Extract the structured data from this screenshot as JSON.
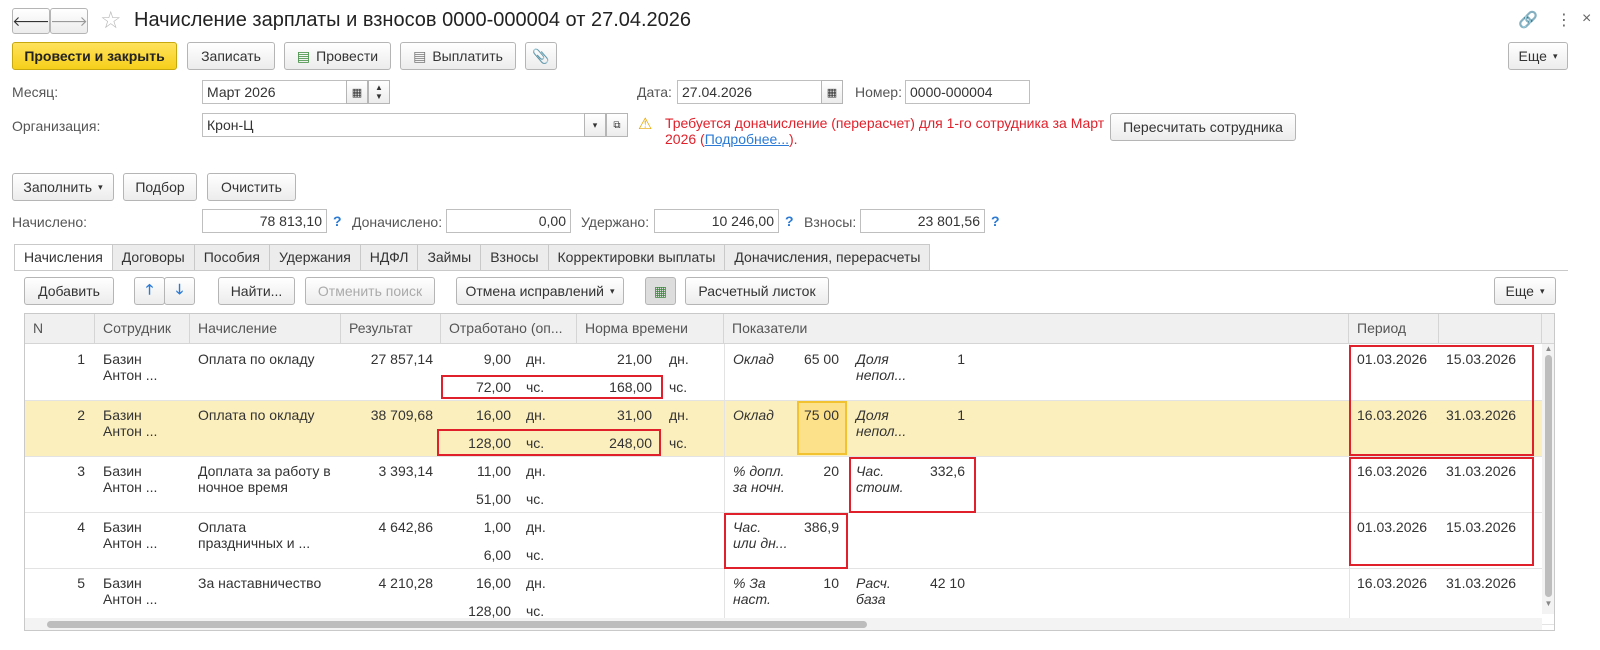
{
  "window": {
    "title": "Начисление зарплаты и взносов 0000-000004 от 27.04.2026"
  },
  "toolbar": {
    "post_close": "Провести и закрыть",
    "save": "Записать",
    "post": "Провести",
    "pay": "Выплатить",
    "more": "Еще"
  },
  "form": {
    "month_label": "Месяц:",
    "month_value": "Март 2026",
    "date_label": "Дата:",
    "date_value": "27.04.2026",
    "number_label": "Номер:",
    "number_value": "0000-000004",
    "org_label": "Организация:",
    "org_value": "Крон-Ц",
    "warning_text": "Требуется доначисление (перерасчет) для 1-го сотрудника за Март 2026 (",
    "warning_link": "Подробнее...",
    "warning_end": ").",
    "recalc_button": "Пересчитать сотрудника"
  },
  "actions": {
    "fill": "Заполнить",
    "select": "Подбор",
    "clear": "Очистить"
  },
  "totals": {
    "accrued_label": "Начислено:",
    "accrued_value": "78 813,10",
    "extra_label": "Доначислено:",
    "extra_value": "0,00",
    "withheld_label": "Удержано:",
    "withheld_value": "10 246,00",
    "contrib_label": "Взносы:",
    "contrib_value": "23 801,56",
    "help": "?"
  },
  "tabs": [
    "Начисления",
    "Договоры",
    "Пособия",
    "Удержания",
    "НДФЛ",
    "Займы",
    "Взносы",
    "Корректировки выплаты",
    "Доначисления, перерасчеты"
  ],
  "grid_toolbar": {
    "add": "Добавить",
    "find": "Найти...",
    "cancel_search": "Отменить поиск",
    "cancel_fixes": "Отмена исправлений",
    "payslip": "Расчетный листок",
    "more": "Еще"
  },
  "columns": {
    "n": "N",
    "employee": "Сотрудник",
    "accrual": "Начисление",
    "result": "Результат",
    "worked": "Отработано (оп...",
    "norm": "Норма времени",
    "indicators": "Показатели",
    "period": "Период"
  },
  "rows": [
    {
      "n": "1",
      "emp1": "Базин",
      "emp2": "Антон ...",
      "acc1": "Оплата по окладу",
      "acc2": "",
      "result": "27 857,14",
      "w1": "9,00",
      "wu1": "дн.",
      "w2": "72,00",
      "wu2": "чс.",
      "n1": "21,00",
      "nu1": "дн.",
      "n2": "168,00",
      "nu2": "чс.",
      "i1a": "Оклад",
      "i1v": "65 00",
      "i2a": "Доля",
      "i2b": "непол...",
      "i2v": "1",
      "p1": "01.03.2026",
      "p2": "15.03.2026"
    },
    {
      "n": "2",
      "emp1": "Базин",
      "emp2": "Антон ...",
      "acc1": "Оплата по окладу",
      "acc2": "",
      "result": "38 709,68",
      "w1": "16,00",
      "wu1": "дн.",
      "w2": "128,00",
      "wu2": "чс.",
      "n1": "31,00",
      "nu1": "дн.",
      "n2": "248,00",
      "nu2": "чс.",
      "i1a": "Оклад",
      "i1v": "75 00",
      "i2a": "Доля",
      "i2b": "непол...",
      "i2v": "1",
      "p1": "16.03.2026",
      "p2": "31.03.2026"
    },
    {
      "n": "3",
      "emp1": "Базин",
      "emp2": "Антон ...",
      "acc1": "Доплата за работу в",
      "acc2": "ночное время",
      "result": "3 393,14",
      "w1": "11,00",
      "wu1": "дн.",
      "w2": "51,00",
      "wu2": "чс.",
      "n1": "",
      "nu1": "",
      "n2": "",
      "nu2": "",
      "i1a": "% допл.",
      "i1b": "за ночн.",
      "i1v": "20",
      "i2a": "Час.",
      "i2b": "стоим.",
      "i2v": "332,6",
      "p1": "16.03.2026",
      "p2": "31.03.2026"
    },
    {
      "n": "4",
      "emp1": "Базин",
      "emp2": "Антон ...",
      "acc1": "Оплата",
      "acc2": "праздничных и ...",
      "result": "4 642,86",
      "w1": "1,00",
      "wu1": "дн.",
      "w2": "6,00",
      "wu2": "чс.",
      "n1": "",
      "nu1": "",
      "n2": "",
      "nu2": "",
      "i1a": "Час.",
      "i1b": "или дн...",
      "i1v": "386,9",
      "i2a": "",
      "i2b": "",
      "i2v": "",
      "p1": "01.03.2026",
      "p2": "15.03.2026"
    },
    {
      "n": "5",
      "emp1": "Базин",
      "emp2": "Антон ...",
      "acc1": "За наставничество",
      "acc2": "",
      "result": "4 210,28",
      "w1": "16,00",
      "wu1": "дн.",
      "w2": "128,00",
      "wu2": "чс.",
      "n1": "",
      "nu1": "",
      "n2": "",
      "nu2": "",
      "i1a": "%  За",
      "i1b": "наст.",
      "i1v": "10",
      "i2a": "Расч.",
      "i2b": "база",
      "i2v": "42 10",
      "p1": "16.03.2026",
      "p2": "31.03.2026"
    }
  ],
  "icons": {
    "back": "arrow-left-icon",
    "forward": "arrow-right-icon",
    "star": "star-icon",
    "link": "link-icon",
    "menu": "kebab-icon",
    "close": "close-icon",
    "warning": "warning-icon"
  },
  "colors": {
    "accent": "#f6cf1a",
    "warning": "#e0202a",
    "link": "#2a7ad6",
    "selected_row": "#fbefbd"
  }
}
